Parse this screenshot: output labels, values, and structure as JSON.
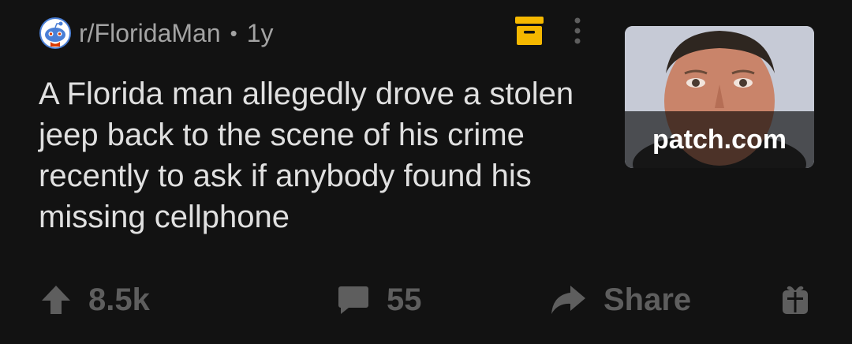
{
  "post": {
    "subreddit": "r/FloridaMan",
    "separator": "•",
    "age": "1y",
    "title": "A Florida man allegedly drove a stolen jeep back to the scene of his crime recently to ask if anybody found his missing cellphone",
    "thumbnail": {
      "domain": "patch.com",
      "icon": "mugshot-photo"
    }
  },
  "actions": {
    "upvotes": "8.5k",
    "comments": "55",
    "share_label": "Share"
  },
  "icons": {
    "subreddit_avatar": "reddit-snoo-icon",
    "save": "archive-box-icon",
    "more": "vertical-dots-icon",
    "upvote": "upvote-arrow-icon",
    "comment": "comment-bubble-icon",
    "share": "share-arrow-icon",
    "award": "gift-award-icon"
  },
  "colors": {
    "background": "#121212",
    "title": "#e0e0e0",
    "meta": "#a3a3a3",
    "save_accent": "#f5b800",
    "actions": "#5e5e5e"
  }
}
